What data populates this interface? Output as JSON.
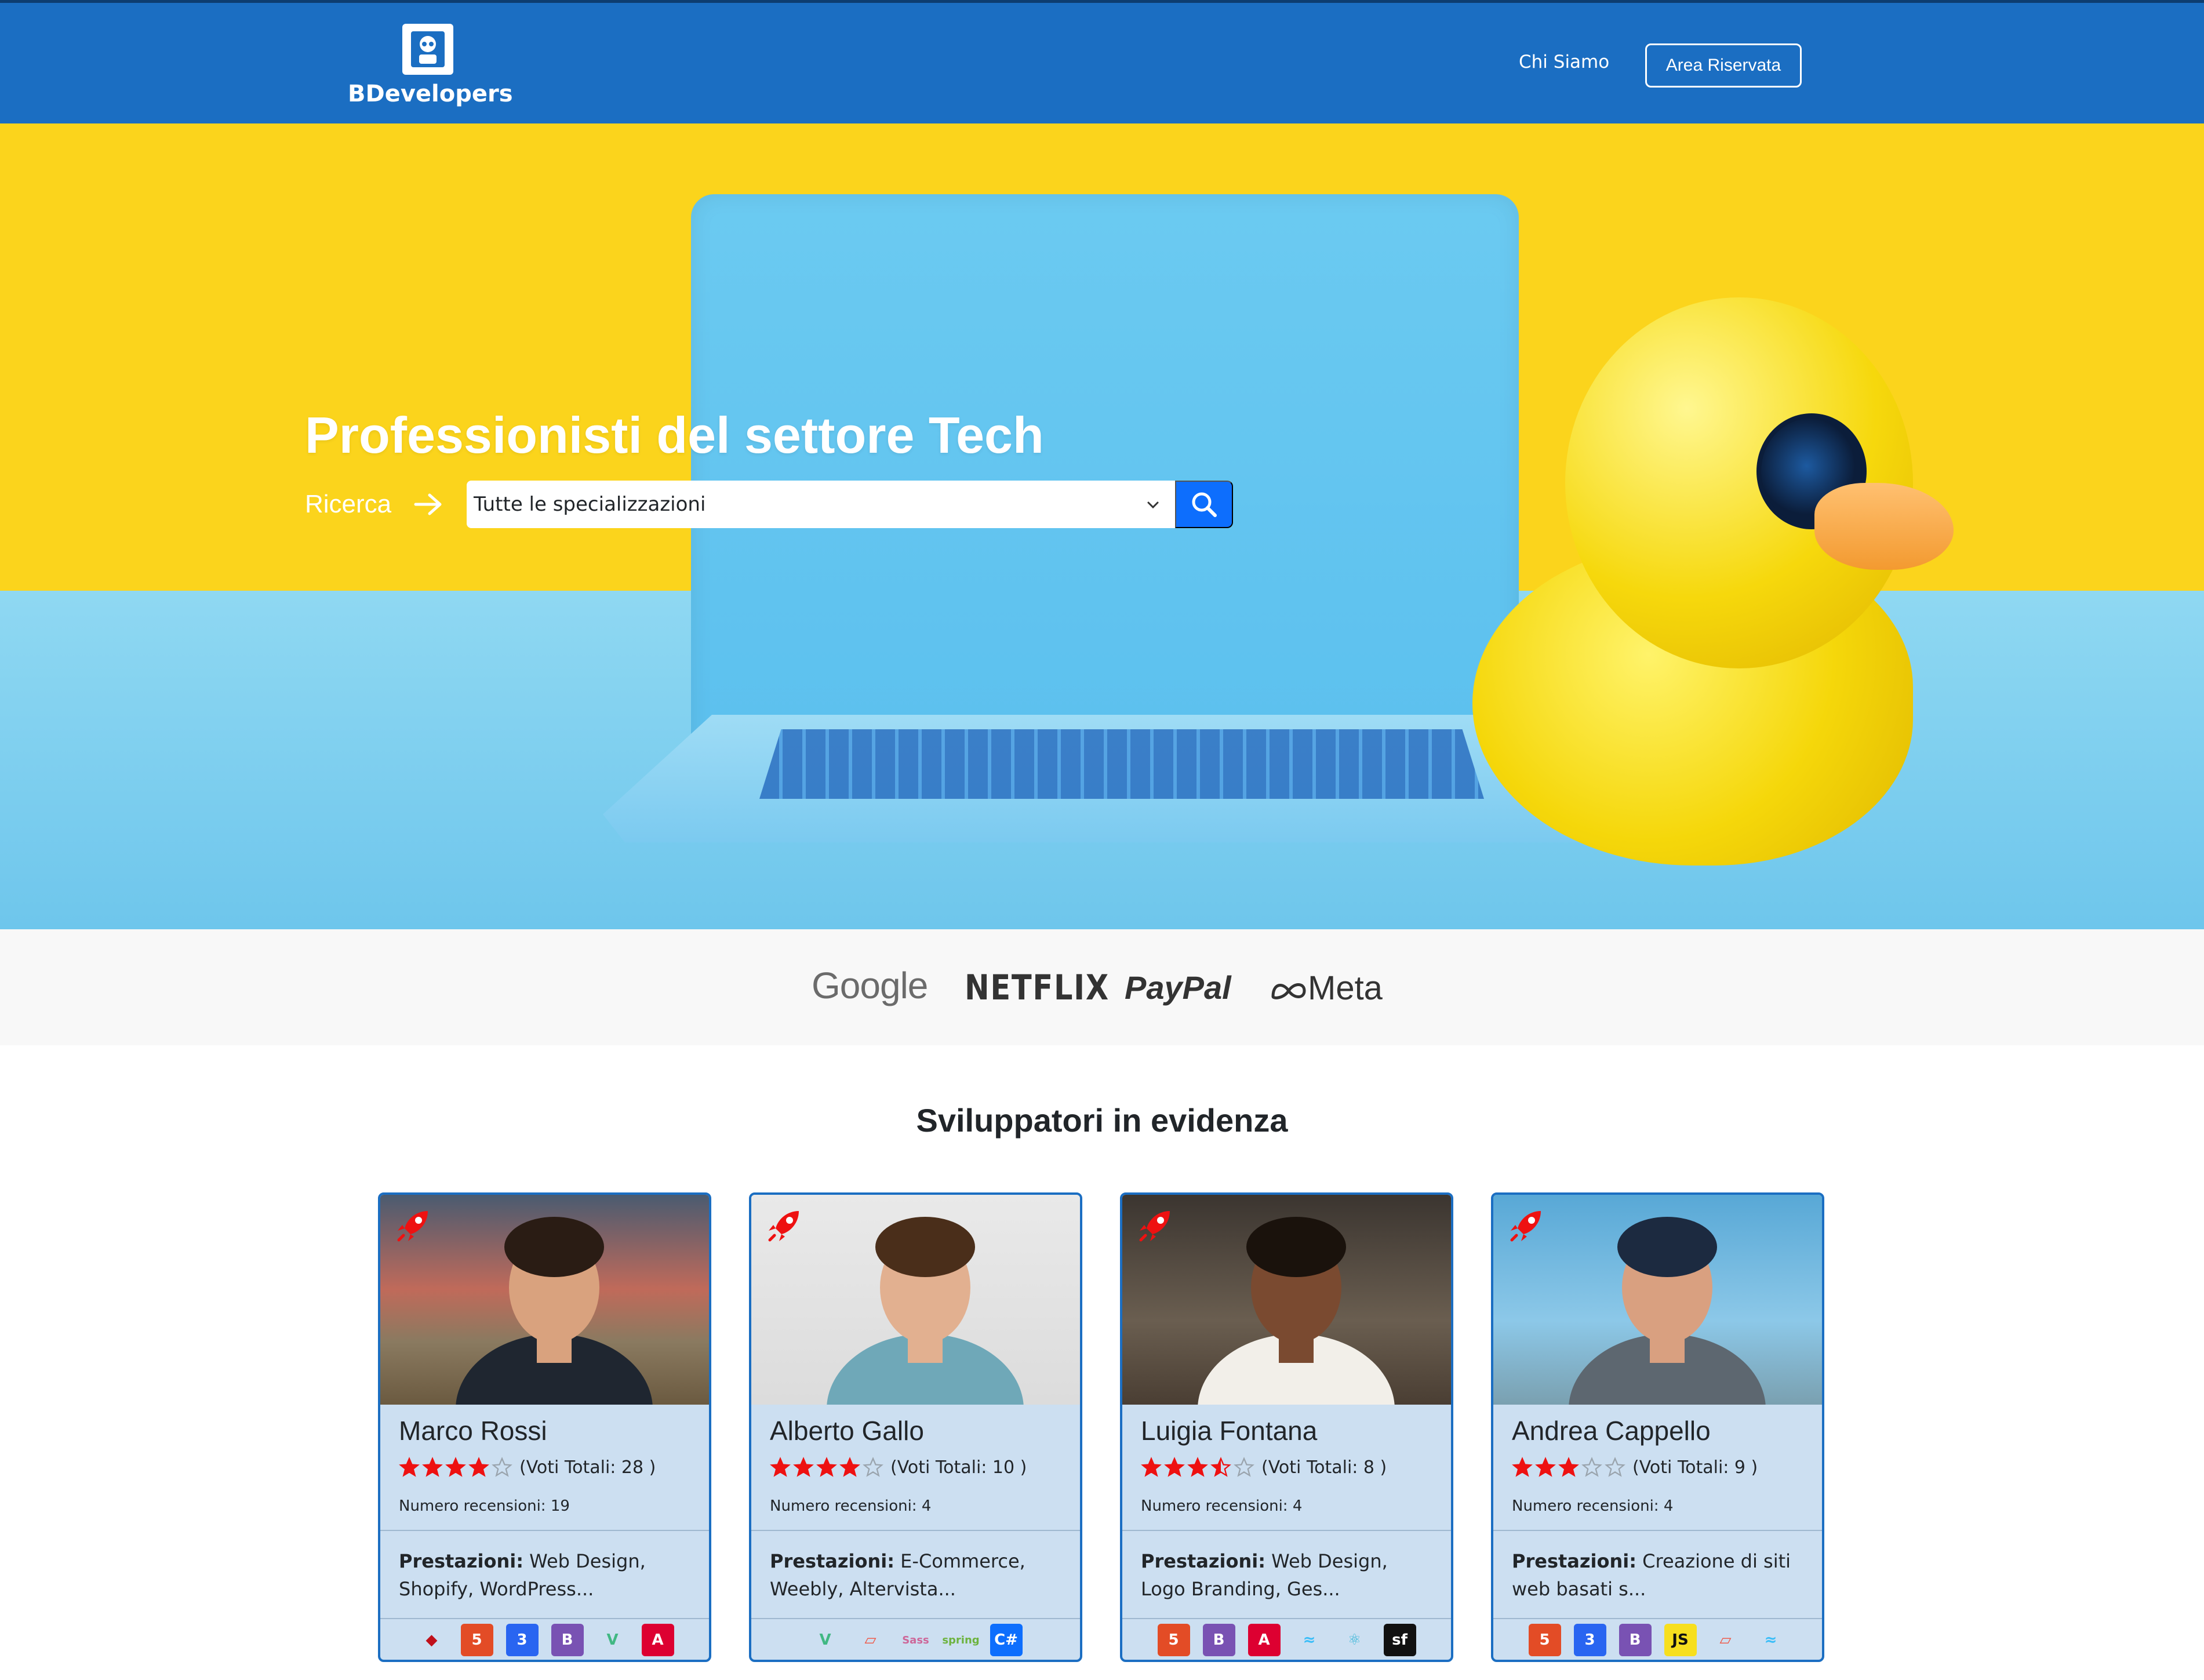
{
  "navbar": {
    "brand_name": "BDevelopers",
    "links": {
      "chi_siamo": "Chi Siamo",
      "area_riservata": "Area Riservata"
    }
  },
  "hero": {
    "title": "Professionisti del settore Tech",
    "search_label": "Ricerca",
    "select_value": "Tutte le specializzazioni"
  },
  "partners": [
    "Google",
    "NETFLIX",
    "PayPal",
    "Meta"
  ],
  "featured": {
    "title": "Sviluppatori in evidenza",
    "developers": [
      {
        "name": "Marco Rossi",
        "rating": 4,
        "votes_text": "(Voti Totali: 28 )",
        "reviews_text": "Numero recensioni: 19",
        "services_label": "Prestazioni:",
        "services": "Web Design, Shopify, WordPress...",
        "techs": [
          "ruby-icon",
          "html5-icon",
          "css3-icon",
          "bootstrap-icon",
          "vue-icon",
          "angular-icon"
        ]
      },
      {
        "name": "Alberto Gallo",
        "rating": 4,
        "votes_text": "(Voti Totali: 10 )",
        "reviews_text": "Numero recensioni: 4",
        "services_label": "Prestazioni:",
        "services": "E-Commerce, Weebly, Altervista...",
        "techs": [
          "vue-icon",
          "laravel-icon",
          "sass-icon",
          "spring-icon",
          "csharp-icon"
        ]
      },
      {
        "name": "Luigia Fontana",
        "rating": 3.5,
        "votes_text": "(Voti Totali: 8 )",
        "reviews_text": "Numero recensioni: 4",
        "services_label": "Prestazioni:",
        "services": "Web Design, Logo Branding, Ges...",
        "techs": [
          "html5-icon",
          "bootstrap-icon",
          "angular-icon",
          "tailwind-icon",
          "react-icon",
          "symfony-icon"
        ]
      },
      {
        "name": "Andrea Cappello",
        "rating": 3,
        "votes_text": "(Voti Totali: 9 )",
        "reviews_text": "Numero recensioni: 4",
        "services_label": "Prestazioni:",
        "services": "Creazione di siti web basati s...",
        "techs": [
          "html5-icon",
          "css3-icon",
          "bootstrap-icon",
          "javascript-icon",
          "laravel-icon",
          "tailwind-icon"
        ]
      }
    ]
  },
  "tech_labels": {
    "bootstrap": "B",
    "javascript": "JS",
    "csharp": "C#",
    "symfony": "sf",
    "html5": "5",
    "css3": "3",
    "angular": "A",
    "vue": "V",
    "sass": "Sass",
    "spring": "spring"
  },
  "colors": {
    "navbar": "#1b6ec2",
    "card_bg": "#ccdff1",
    "accent": "#0d6efd",
    "star": "#ee1111"
  }
}
